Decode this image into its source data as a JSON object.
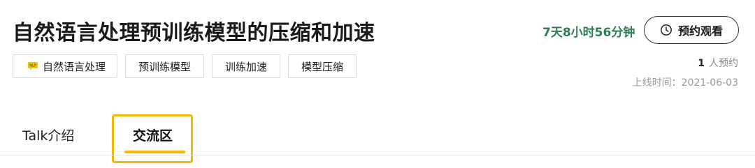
{
  "header": {
    "title": "自然语言处理预训练模型的压缩和加速"
  },
  "tags": [
    {
      "label": "自然语言处理",
      "icon": "nlp-icon"
    },
    {
      "label": "预训练模型"
    },
    {
      "label": "训练加速"
    },
    {
      "label": "模型压缩"
    }
  ],
  "countdown": "7天8小时56分钟",
  "reserve": {
    "label": "预约观看",
    "icon": "clock-icon",
    "count": "1",
    "count_suffix": "人预约"
  },
  "online_time": "上线时间：2021-06-03",
  "tabs": [
    {
      "label": "Talk介绍",
      "active": false
    },
    {
      "label": "交流区",
      "active": true
    }
  ],
  "colors": {
    "accent": "#f5b800",
    "countdown": "#2e7d55"
  }
}
